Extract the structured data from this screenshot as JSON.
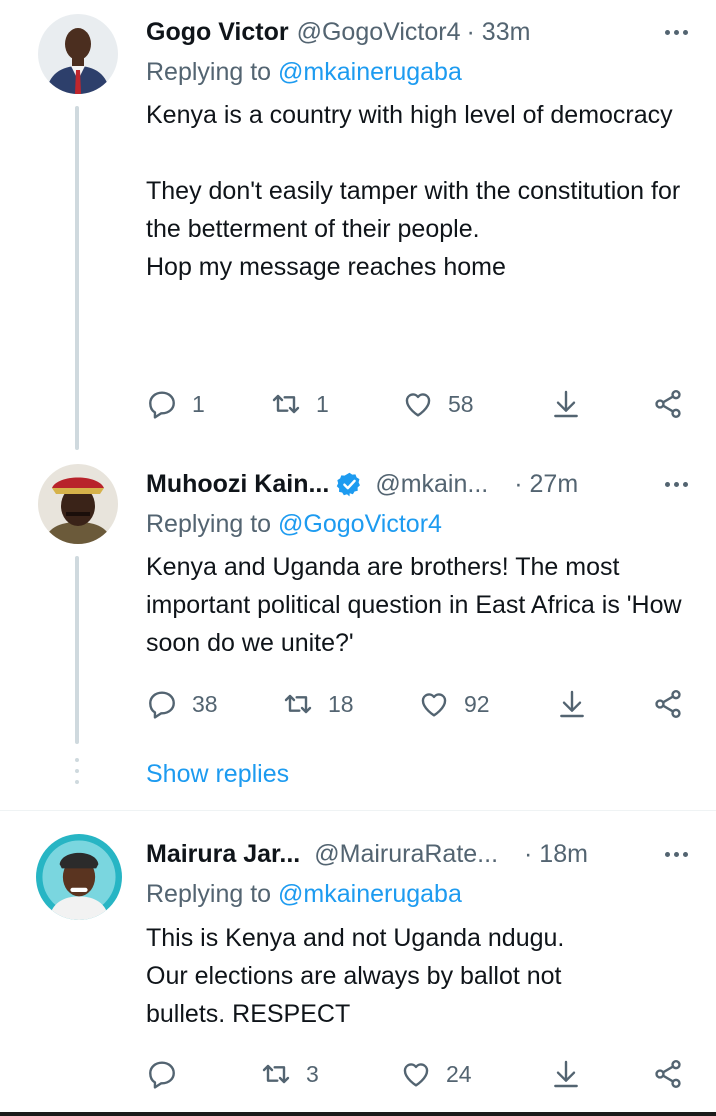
{
  "tweets": [
    {
      "name": "Gogo Victor",
      "handle": "@GogoVictor4",
      "time": "· 33m",
      "replying_prefix": "Replying to ",
      "replying_to": "@mkainerugaba",
      "paragraphs": [
        "Kenya is a country with high level of democracy",
        "",
        "They don't easily tamper with the constitution for the betterment of their people.",
        "Hop my message reaches home"
      ],
      "replies": "1",
      "retweets": "1",
      "likes": "58"
    },
    {
      "name": "Muhoozi Kain...",
      "handle": "@mkain...",
      "time": "· 27m",
      "replying_prefix": "Replying to ",
      "replying_to": "@GogoVictor4",
      "paragraphs": [
        "Kenya and Uganda are brothers! The most important political question in East Africa is 'How soon do we unite?'"
      ],
      "replies": "38",
      "retweets": "18",
      "likes": "92"
    },
    {
      "name": "Mairura Jar...",
      "handle": "@MairuraRate...",
      "time": "· 18m",
      "replying_prefix": "Replying to ",
      "replying_to": "@mkainerugaba",
      "paragraphs": [
        "This is Kenya and not Uganda ndugu.",
        "Our elections are always by ballot not bullets. RESPECT"
      ],
      "replies": "",
      "retweets": "3",
      "likes": "24"
    }
  ],
  "show_replies": "Show replies",
  "icons": {
    "reply": "reply-icon",
    "retweet": "retweet-icon",
    "like": "heart-icon",
    "save": "download-icon",
    "share": "share-icon",
    "verified": "verified-badge-icon",
    "more": "more-icon"
  },
  "colors": {
    "link": "#1d9bf0",
    "muted": "#536471",
    "text": "#0f1419",
    "line": "#cfd9de"
  }
}
